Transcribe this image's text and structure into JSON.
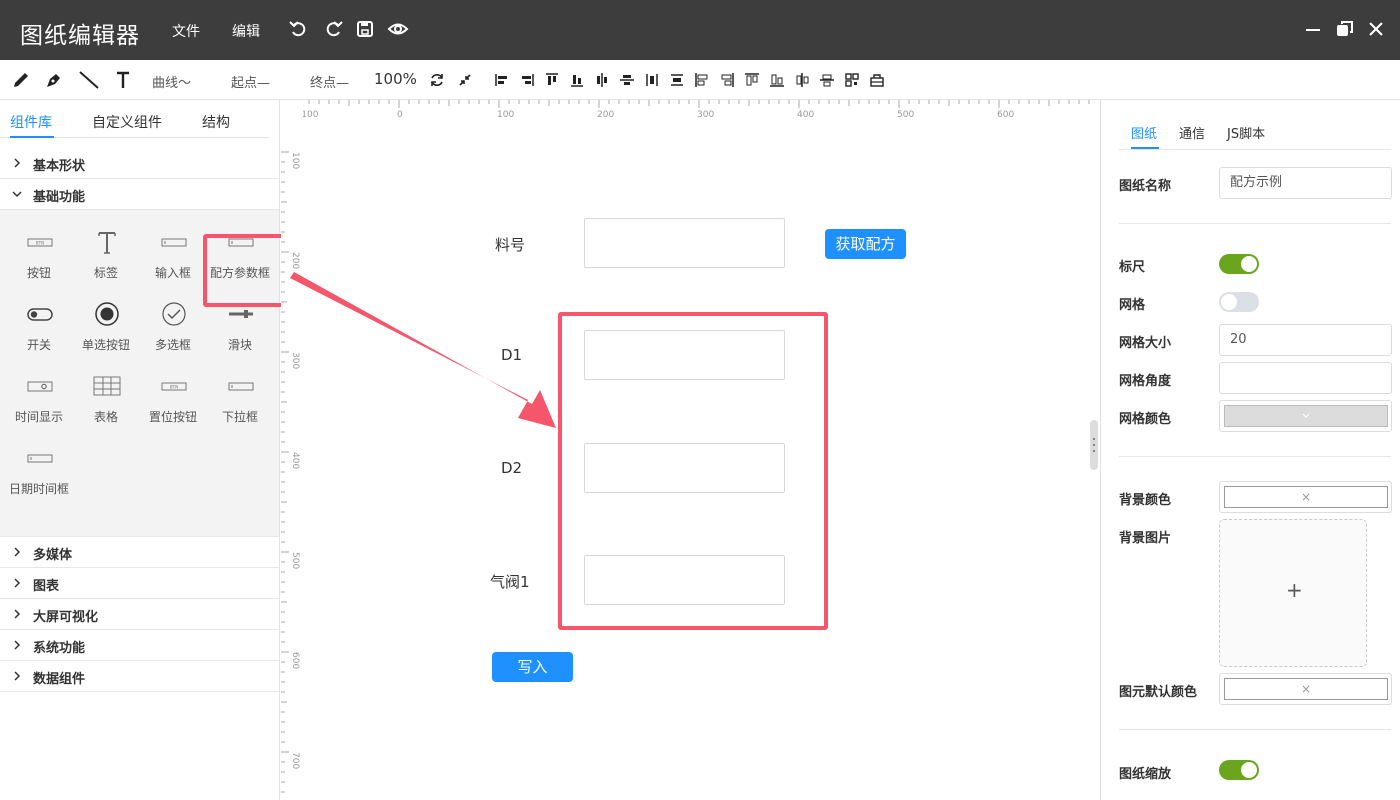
{
  "titlebar": {
    "app_title": "图纸编辑器",
    "menu": [
      "文件",
      "编辑"
    ]
  },
  "toolbar": {
    "curve_label": "曲线～",
    "start_label": "起点—",
    "end_label": "终点—",
    "zoom": "100%"
  },
  "left": {
    "tabs": [
      "组件库",
      "自定义组件",
      "结构"
    ],
    "categories_top": [
      "基本形状",
      "基础功能"
    ],
    "components": [
      "按钮",
      "标签",
      "输入框",
      "配方参数框",
      "开关",
      "单选按钮",
      "多选框",
      "滑块",
      "时间显示",
      "表格",
      "置位按钮",
      "下拉框",
      "日期时间框"
    ],
    "categories_bottom": [
      "多媒体",
      "图表",
      "大屏可视化",
      "系统功能",
      "数据组件"
    ]
  },
  "ruler": {
    "top": [
      "-100",
      "0",
      "100",
      "200",
      "300",
      "400",
      "500",
      "600"
    ],
    "left": [
      "100",
      "200",
      "300",
      "400",
      "500",
      "600",
      "700"
    ]
  },
  "canvas": {
    "label_material": "料号",
    "btn_get_recipe": "获取配方",
    "label_d1": "D1",
    "label_d2": "D2",
    "label_valve": "气阀1",
    "btn_write": "写入"
  },
  "right": {
    "tabs": [
      "图纸",
      "通信",
      "JS脚本"
    ],
    "name_label": "图纸名称",
    "name_value": "配方示例",
    "ruler_label": "标尺",
    "ruler_on": true,
    "grid_label": "网格",
    "grid_on": false,
    "grid_size_label": "网格大小",
    "grid_size_value": "20",
    "grid_angle_label": "网格角度",
    "grid_angle_value": "",
    "grid_color_label": "网格颜色",
    "bg_color_label": "背景颜色",
    "bg_image_label": "背景图片",
    "upload_plus": "+",
    "default_color_label": "图元默认颜色",
    "zoom_label": "图纸缩放",
    "zoom_on": true,
    "clear_symbol": "×"
  },
  "colors": {
    "accent": "#1e90ff",
    "toggle_on": "#6aa51e",
    "toggle_off": "#dcdfe6",
    "highlight": "#f5566b",
    "titlebar": "#3d3d3d"
  }
}
